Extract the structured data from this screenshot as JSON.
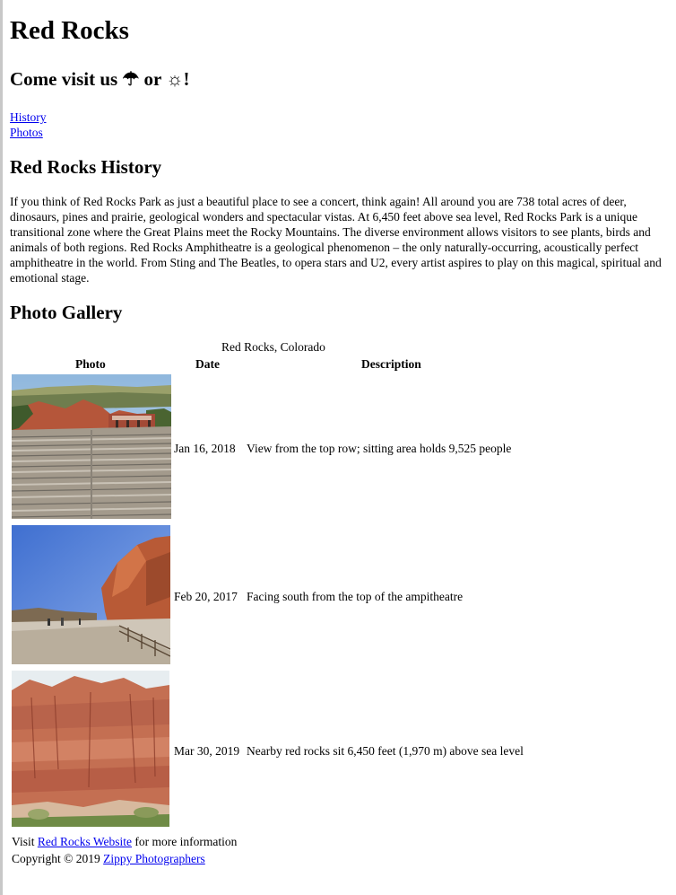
{
  "header": {
    "title": "Red Rocks",
    "subtitle_prefix": "Come visit us ",
    "umbrella_glyph": "☂",
    "subtitle_mid": " or ",
    "sun_glyph": "☼",
    "subtitle_suffix": "!"
  },
  "nav": {
    "items": [
      {
        "label": "History"
      },
      {
        "label": "Photos"
      }
    ]
  },
  "history": {
    "heading": "Red Rocks History",
    "text": "If you think of Red Rocks Park as just a beautiful place to see a concert, think again! All around you are 738 total acres of deer, dinosaurs, pines and prairie, geological wonders and spectacular vistas. At 6,450 feet above sea level, Red Rocks Park is a unique transitional zone where the Great Plains meet the Rocky Mountains. The diverse environment allows visitors to see plants, birds and animals of both regions. Red Rocks Amphitheatre is a geological phenomenon – the only naturally-occurring, acoustically perfect amphitheatre in the world. From Sting and The Beatles, to opera stars and U2, every artist aspires to play on this magical, spiritual and emotional stage."
  },
  "gallery": {
    "heading": "Photo Gallery",
    "caption": "Red Rocks, Colorado",
    "columns": [
      "Photo",
      "Date",
      "Description"
    ],
    "rows": [
      {
        "photo": "amphitheatre-top-row-photo",
        "date": "Jan 16, 2018",
        "description": "View from the top row; sitting area holds 9,525 people"
      },
      {
        "photo": "ampitheatre-facing-south-photo",
        "date": "Feb 20, 2017",
        "description": "Facing south from the top of the ampitheatre"
      },
      {
        "photo": "red-rocks-closeup-photo",
        "date": "Mar 30, 2019",
        "description": "Nearby red rocks sit 6,450 feet (1,970 m) above sea level"
      }
    ]
  },
  "footer": {
    "visit_prefix": "Visit ",
    "website_link": "Red Rocks Website",
    "visit_suffix": " for more information",
    "copyright_prefix": "Copyright © 2019 ",
    "company_link": "Zippy Photographers"
  },
  "colors": {
    "link": "#0000ee",
    "text": "#000000",
    "background": "#ffffff"
  }
}
